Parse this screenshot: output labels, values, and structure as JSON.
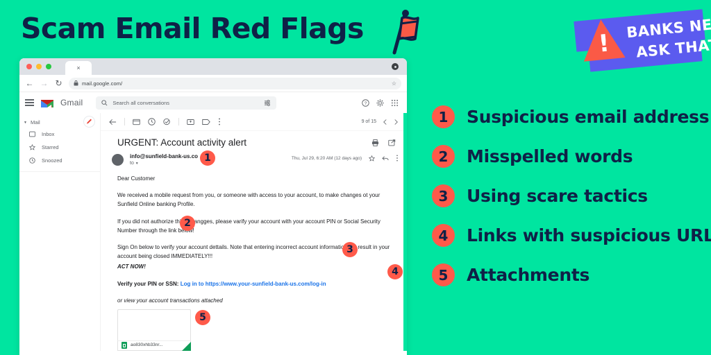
{
  "headline": "Scam Email Red Flags",
  "colors": {
    "background": "#00E5A0",
    "navy": "#0F2147",
    "red": "#FF5A4A",
    "badge_purple": "#5B5BEF",
    "link_blue": "#1A73E8"
  },
  "logo_badge": {
    "line1": "BANKS NEVER",
    "line2": "ASK THAT",
    "exclamation": "!"
  },
  "flag_list": [
    {
      "number": "1",
      "label": "Suspicious email address"
    },
    {
      "number": "2",
      "label": "Misspelled words"
    },
    {
      "number": "3",
      "label": "Using scare tactics"
    },
    {
      "number": "4",
      "label": "Links with suspicious URLs"
    },
    {
      "number": "5",
      "label": "Attachments"
    }
  ],
  "overlay_badges": [
    "1",
    "2",
    "3",
    "4",
    "5"
  ],
  "browser": {
    "tab_close": "×",
    "url": "mail.google.com/",
    "back": "←",
    "forward": "→",
    "reload": "↻",
    "lock_icon": "lock-icon",
    "bookmark_icon": "star-icon"
  },
  "gmail": {
    "brand": "Gmail",
    "search_placeholder": "Search all conversations",
    "sidebar": {
      "section": "Mail",
      "items": [
        {
          "label": "Inbox",
          "icon": "inbox-icon"
        },
        {
          "label": "Starred",
          "icon": "star-icon"
        },
        {
          "label": "Snoozed",
          "icon": "clock-icon"
        }
      ]
    },
    "toolbar": {
      "pager": "9 of 15"
    },
    "email": {
      "subject": "URGENT: Account activity alert",
      "sender": "info@sunfield-bank-us.co",
      "to_label": "to",
      "date": "Thu, Jul 29, 6:20 AM (12 days ago)",
      "greeting": "Dear Customer",
      "paragraph1": "We received a mobile request from you, or someone with access to your account, to make changes ot your Sunfield Online banking Profile.",
      "paragraph2": "If you did not authorize thise changges, please varify your account with your account PIN or Social Security Number through the link below!",
      "paragraph3": "Sign On below to verify your account dettails. Note that entering incorrect account information will result in your account being closed IMMEDIATELY!!!",
      "act_now": "ACT NOW!",
      "verify_label": "Verify your PIN or SSN:",
      "link_text": "Log in to https://www.your-sunfield-bank-us.com/log-in",
      "attached_note": "or view your account transactions attached",
      "attachment_name": "ao830xhb33nr..."
    }
  }
}
